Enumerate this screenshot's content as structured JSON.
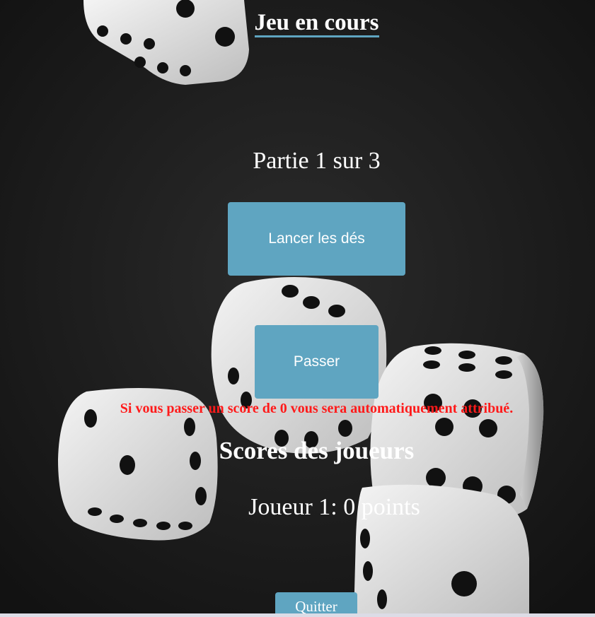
{
  "header": {
    "title": "Jeu en cours"
  },
  "game": {
    "round_label": "Partie 1 sur 3"
  },
  "actions": {
    "roll_label": "Lancer les dés",
    "pass_label": "Passer",
    "pass_warning": "Si vous passer un score de 0 vous sera automatiquement attribué.",
    "quit_label": "Quitter"
  },
  "scores": {
    "heading": "Scores des joueurs",
    "players": [
      {
        "text": "Joueur 1: 0 points"
      }
    ]
  },
  "colors": {
    "accent": "#5fa5c1",
    "warning": "#ff1a1a",
    "background": "#1b1b1b",
    "text": "#ffffff"
  },
  "icons": {
    "background_image": "dice-photo"
  }
}
